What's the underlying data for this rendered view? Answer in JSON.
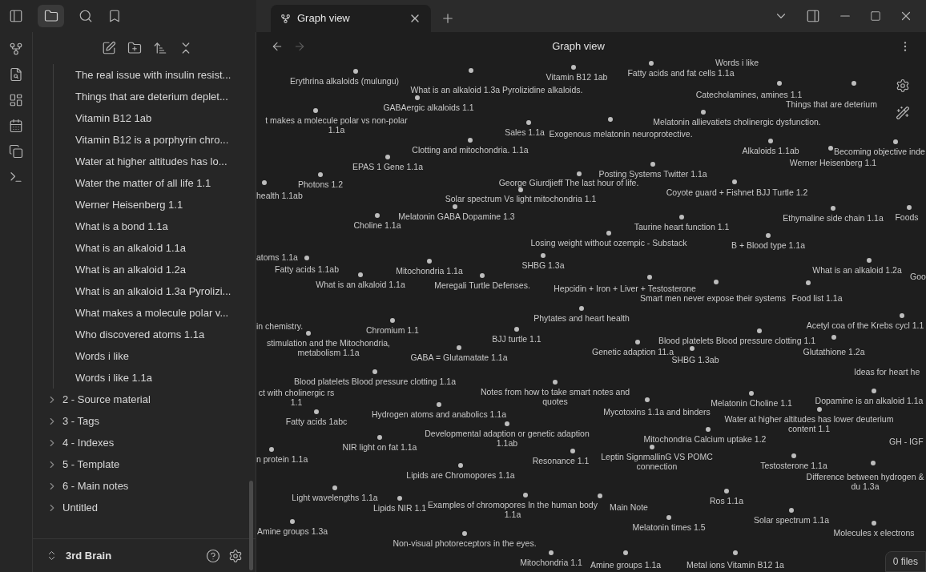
{
  "tab_bar": {
    "tabs": [
      {
        "title": "Graph view",
        "selected": true
      }
    ]
  },
  "sidebar": {
    "files": [
      "The real issue with insulin resist...",
      "Things that are deterium deplet...",
      "Vitamin B12 1ab",
      "Vitamin B12 is a porphyrin chro...",
      "Water at higher altitudes has lo...",
      "Water the matter of all life 1.1",
      "Werner Heisenberg 1.1",
      "What is a bond 1.1a",
      "What is an alkaloid 1.1a",
      "What is an alkaloid 1.2a",
      "What is an alkaloid 1.3a Pyrolizi...",
      "What makes a molecule polar v...",
      "Who discovered atoms 1.1a",
      "Words i like",
      "Words i like 1.1a"
    ],
    "folders": [
      {
        "name": "2 - Source material",
        "expanded": false
      },
      {
        "name": "3 - Tags",
        "expanded": false
      },
      {
        "name": "4 - Indexes",
        "expanded": false
      },
      {
        "name": "5 - Template",
        "expanded": false
      },
      {
        "name": "6 - Main notes",
        "expanded": false
      },
      {
        "name": "Untitled",
        "expanded": false
      }
    ],
    "vault": "3rd Brain"
  },
  "graph": {
    "title": "Graph view",
    "status": "0 files",
    "nodes": [
      "Erythrina alkaloids (mulungu)",
      "What is an alkaloid 1.3a Pyrolizidine alkaloids.",
      "Vitamin B12 1ab",
      "Fatty acids and fat cells 1.1a",
      "Words i like",
      "Catecholamines, amines 1.1",
      "Things that are deterium",
      "t makes a molecule polar vs non-polar 1.1a",
      "GABAergic alkaloids 1.1",
      "Sales 1.1a",
      "Clotting and mitochondria. 1.1a",
      "Exogenous melatonin neuroprotective.",
      "Melatonin allievatiets cholinergic dysfunction.",
      "Alkaloids 1.1ab",
      "Werner Heisenberg 1.1",
      "Becoming objective inde",
      "EPAS 1 Gene 1.1a",
      "Photons 1.2",
      "health 1.1ab",
      "Posting Systems Twitter 1.1a",
      "George Giurdjieff The last hour of life.",
      "Coyote guard + Fishnet BJJ Turtle 1.2",
      "Solar spectrum Vs light mitochondria 1.1",
      "Melatonin GABA Dopamine 1.3",
      "Choline 1.1a",
      "Taurine heart function 1.1",
      "Ethymaline side chain 1.1a",
      "Foods",
      "Losing weight without ozempic - Substack",
      "B + Blood type 1.1a",
      "atoms 1.1a",
      "Fatty acids 1.1ab",
      "Mitochondria 1.1a",
      "SHBG 1.3a",
      "What is an alkaloid 1.1a",
      "Meregali Turtle Defenses.",
      "What is an alkaloid 1.2a",
      "Goo",
      "Hepcidin + Iron + Liver + Testosterone",
      "Smart men never expose their systems",
      "Food list 1.1a",
      "Phytates and heart health",
      "in chemistry.",
      "stimulation and the Mitochondria, metabolism 1.1a",
      "Chromium 1.1",
      "BJJ turtle 1.1",
      "GABA = Glutamatate 1.1a",
      "Genetic adaption 11.a",
      "Blood platelets  Blood pressure clotting 1.1",
      "SHBG 1.3ab",
      "Acetyl coa of the Krebs cycl 1.1",
      "Glutathione 1.2a",
      "Ideas for heart he",
      "Blood platelets  Blood pressure clotting 1.1a",
      "ct with cholinergic rs 1.1",
      "Fatty acids 1abc",
      "Hydrogen atoms and anabolics 1.1a",
      "Notes from how to take smart notes and quotes",
      "Mycotoxins 1.1a and binders",
      "Melatonin Choline 1.1",
      "Dopamine is an alkaloid 1.1a",
      "Developmental adaption or genetic adaption 1.1ab",
      "Water at higher altitudes has lower deuterium content 1.1",
      "Mitochondria Calcium uptake 1.2",
      "GH - IGF",
      "NIR light on fat 1.1a",
      "n protein 1.1a",
      "Resonance 1.1",
      "Leptin SignmallinG VS POMC connection",
      "Testosterone 1.1a",
      "Lipids are Chromopores 1.1a",
      "Difference between hydrogen & du 1.3a",
      "Light wavelengths 1.1a",
      "Lipids NIR 1.1",
      "Examples of chromopores In the human body 1.1a",
      "Main Note",
      "Ros 1.1a",
      "Amine groups 1.3a",
      "Melatonin times 1.5",
      "Solar spectrum 1.1a",
      "Molecules x electrons",
      "Non-visual photoreceptors in the eyes.",
      "Mitochondria 1.1",
      "Amine groups 1.1a",
      "Metal ions Vitamin B12 1a"
    ]
  }
}
